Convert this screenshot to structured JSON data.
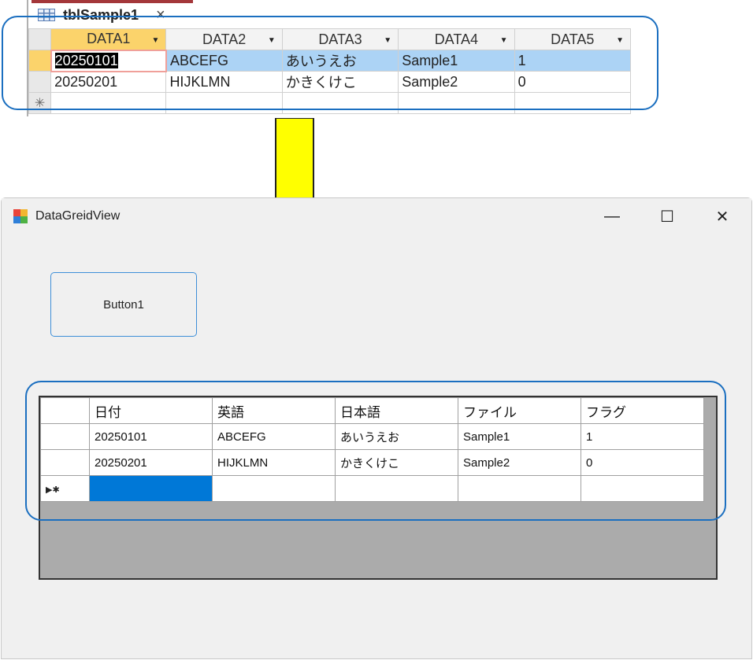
{
  "access": {
    "tab_title": "tblSample1",
    "tab_close": "×",
    "columns": [
      "DATA1",
      "DATA2",
      "DATA3",
      "DATA4",
      "DATA5"
    ],
    "rows": [
      [
        "20250101",
        "ABCEFG",
        "あいうえお",
        "Sample1",
        "1"
      ],
      [
        "20250201",
        "HIJKLMN",
        "かきくけこ",
        "Sample2",
        "0"
      ]
    ],
    "new_row_marker": "✳"
  },
  "window": {
    "title": "DataGreidView",
    "minimize": "—",
    "maximize": "☐",
    "close": "✕",
    "button1_label": "Button1"
  },
  "grid": {
    "columns": [
      "日付",
      "英語",
      "日本語",
      "ファイル",
      "フラグ"
    ],
    "rows": [
      [
        "20250101",
        "ABCEFG",
        "あいうえお",
        "Sample1",
        "1"
      ],
      [
        "20250201",
        "HIJKLMN",
        "かきくけこ",
        "Sample2",
        "0"
      ]
    ],
    "new_row_marker": "▶✱"
  },
  "colors": {
    "callout": "#1b6fc0",
    "arrow_fill": "#ffff00",
    "selection_blue": "#0078d7",
    "access_header_selected": "#fbd36b",
    "access_row_selected": "#acd3f5"
  }
}
